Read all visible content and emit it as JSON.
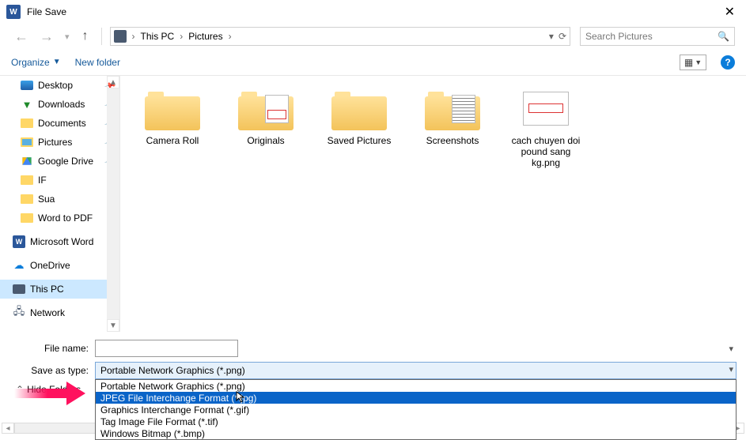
{
  "title": "File Save",
  "breadcrumb": {
    "root": "This PC",
    "folder": "Pictures"
  },
  "search_placeholder": "Search Pictures",
  "toolbar": {
    "organize": "Organize",
    "new_folder": "New folder"
  },
  "sidebar": {
    "items": [
      {
        "label": "Desktop",
        "icon": "desktop",
        "pinned": true
      },
      {
        "label": "Downloads",
        "icon": "downloads",
        "pinned": true
      },
      {
        "label": "Documents",
        "icon": "folder",
        "pinned": true
      },
      {
        "label": "Pictures",
        "icon": "pictures",
        "pinned": true
      },
      {
        "label": "Google Drive",
        "icon": "gdrive",
        "pinned": true
      },
      {
        "label": "IF",
        "icon": "folder",
        "pinned": false
      },
      {
        "label": "Sua",
        "icon": "folder",
        "pinned": false
      },
      {
        "label": "Word to PDF",
        "icon": "folder",
        "pinned": false
      }
    ],
    "groups": [
      {
        "label": "Microsoft Word",
        "icon": "word"
      },
      {
        "label": "OneDrive",
        "icon": "onedrive"
      },
      {
        "label": "This PC",
        "icon": "pc",
        "selected": true
      },
      {
        "label": "Network",
        "icon": "network"
      }
    ]
  },
  "files": [
    {
      "label": "Camera Roll",
      "kind": "folder"
    },
    {
      "label": "Originals",
      "kind": "folder-thumb-red"
    },
    {
      "label": "Saved Pictures",
      "kind": "folder"
    },
    {
      "label": "Screenshots",
      "kind": "folder-thumb-lines"
    },
    {
      "label": "cach chuyen doi pound sang kg.png",
      "kind": "image"
    }
  ],
  "form": {
    "file_name_label": "File name:",
    "file_name_value": "",
    "save_type_label": "Save as type:",
    "save_type_value": "Portable Network Graphics (*.png)",
    "hide_folders": "Hide Folders"
  },
  "type_options": [
    "Portable Network Graphics (*.png)",
    "JPEG File Interchange Format (*.jpg)",
    "Graphics Interchange Format (*.gif)",
    "Tag Image File Format (*.tif)",
    "Windows Bitmap (*.bmp)"
  ],
  "highlighted_option_index": 1
}
